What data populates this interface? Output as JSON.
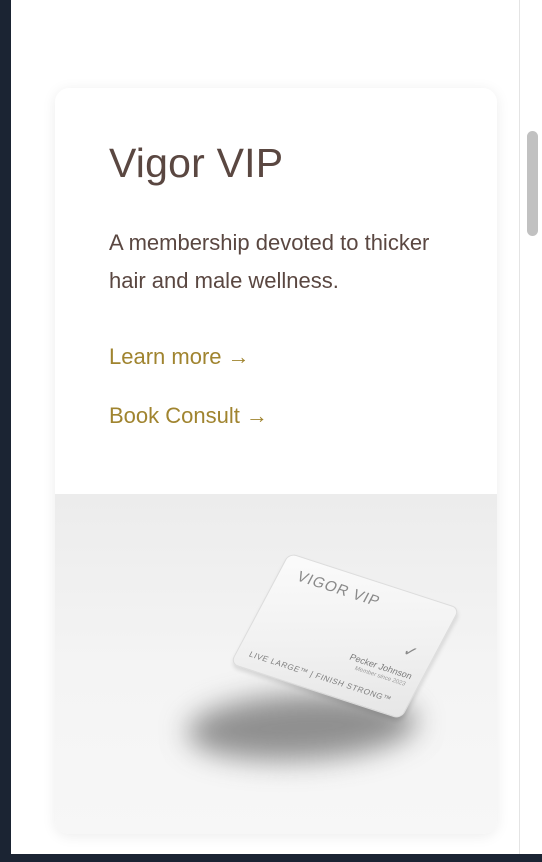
{
  "card": {
    "title": "Vigor VIP",
    "description": "A membership devoted to thicker hair and male wellness.",
    "links": {
      "learn_more": "Learn more",
      "book_consult": "Book Consult",
      "arrow": "→"
    },
    "membership_card": {
      "brand": "VIGOR VIP",
      "check": "✓",
      "member_name": "Pecker Johnson",
      "member_since": "Member since 2023",
      "tagline": "LIVE LARGE™ | FINISH STRONG™"
    }
  },
  "colors": {
    "title_text": "#5a4741",
    "link_accent": "#a0842f",
    "frame_background": "#1b2433"
  },
  "icons": {
    "link_arrow": "arrow-right-icon",
    "card_check": "checkmark-icon"
  }
}
